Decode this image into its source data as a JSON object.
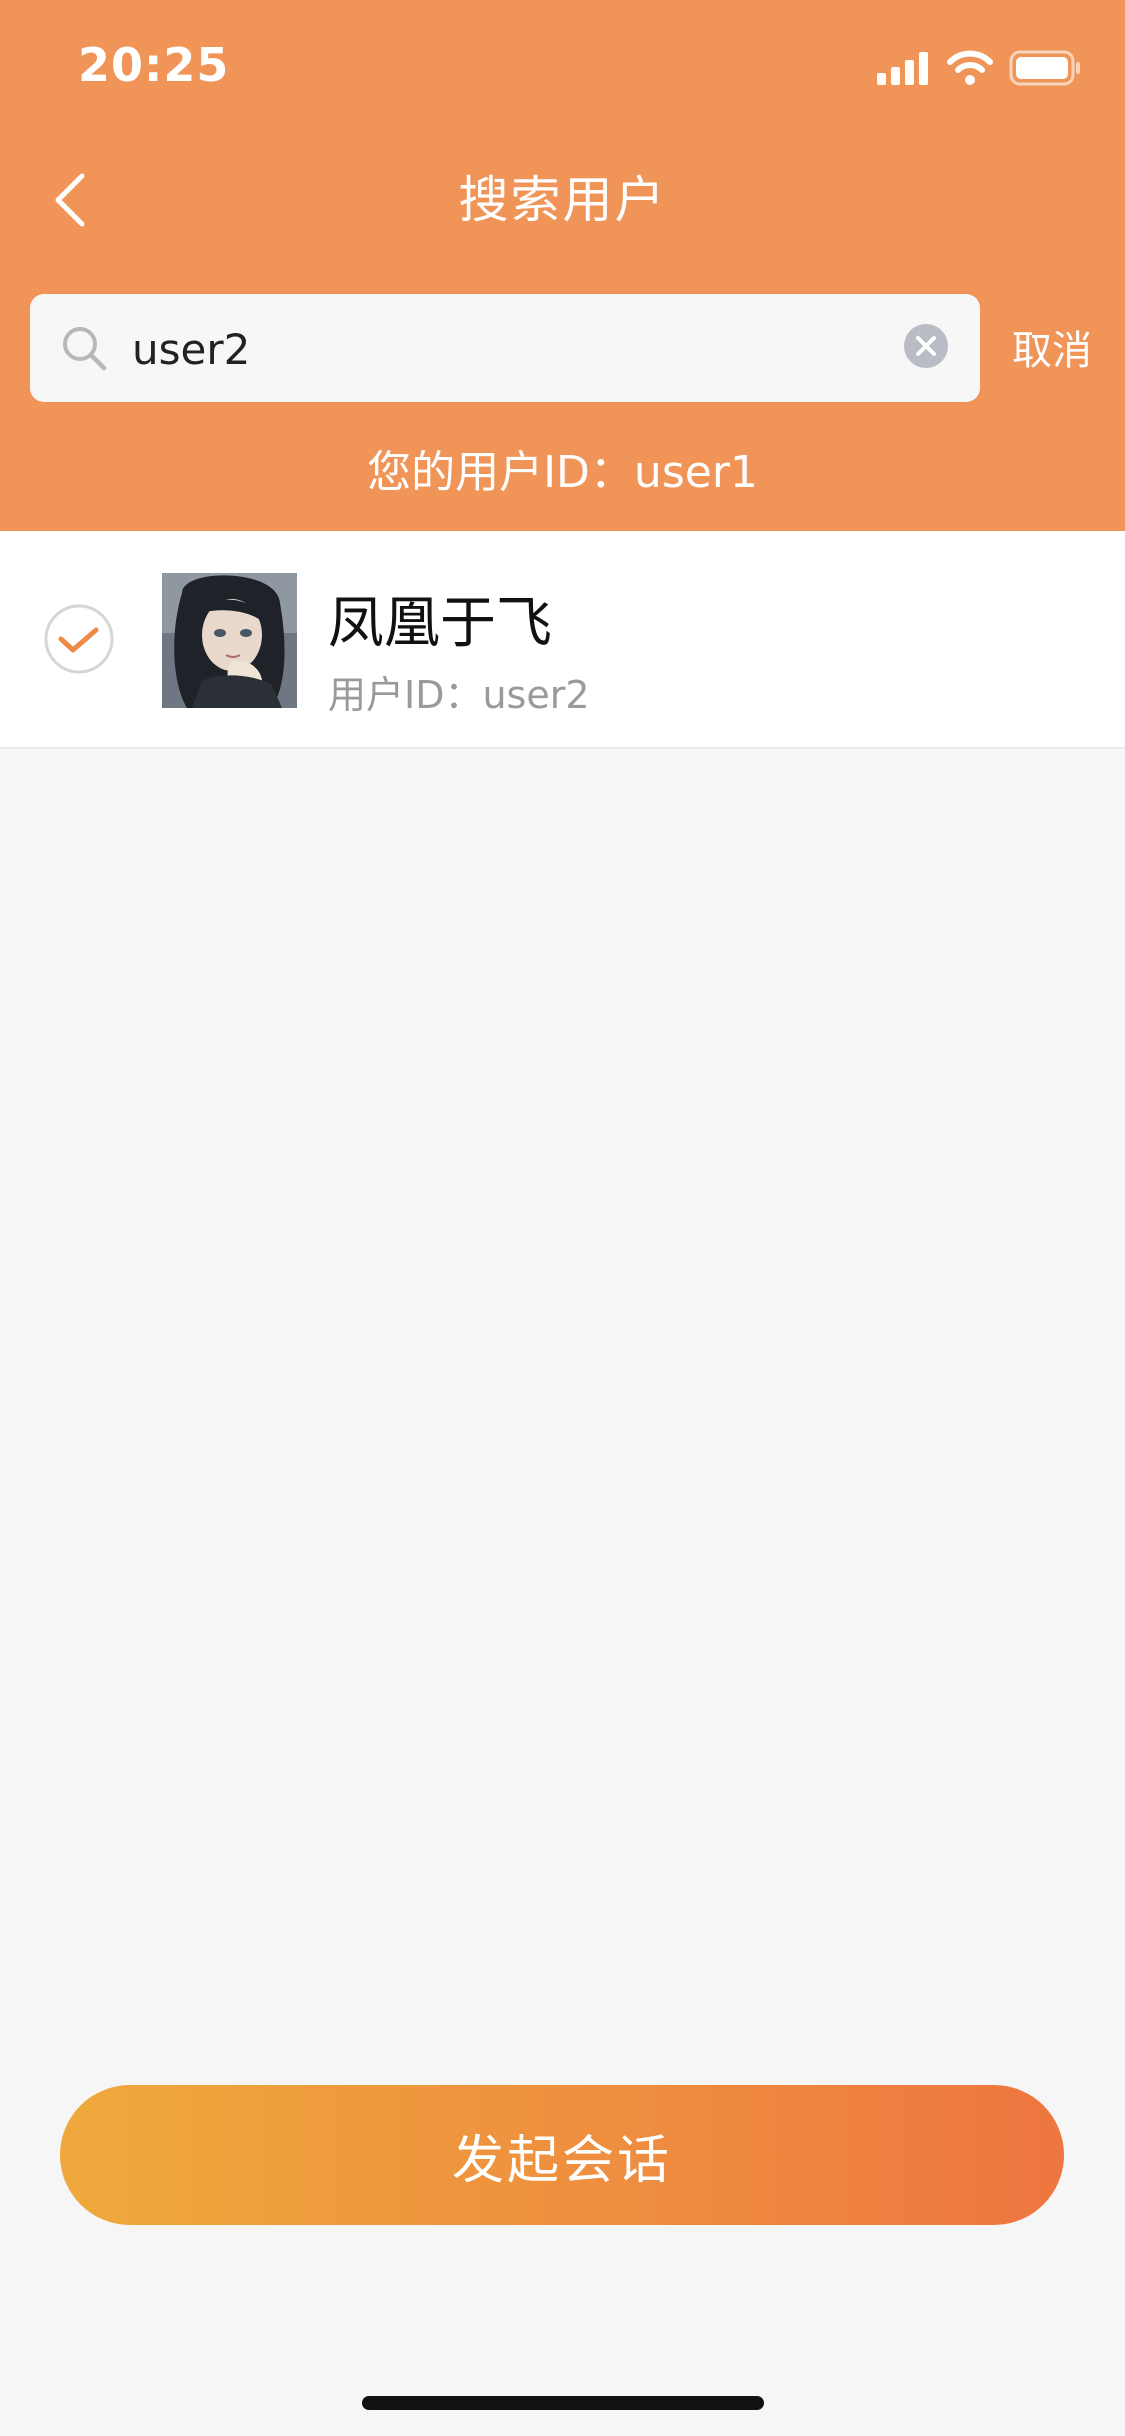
{
  "status_bar": {
    "time": "20:25"
  },
  "header": {
    "title": "搜索用户"
  },
  "search": {
    "value": "user2",
    "cancel_label": "取消"
  },
  "current_user": {
    "line": "您的用户ID：user1"
  },
  "results": [
    {
      "name": "凤凰于飞",
      "id_line": "用户ID：user2",
      "selected": true
    }
  ],
  "actions": {
    "start_label": "发起会话"
  },
  "colors": {
    "primary": "#f09457",
    "check": "#ee8a47",
    "gradient_start": "#efa93b",
    "gradient_end": "#ee7640"
  },
  "icons": [
    "back-arrow-icon",
    "search-icon",
    "clear-icon",
    "check-icon",
    "signal-icon",
    "wifi-icon",
    "battery-icon"
  ]
}
